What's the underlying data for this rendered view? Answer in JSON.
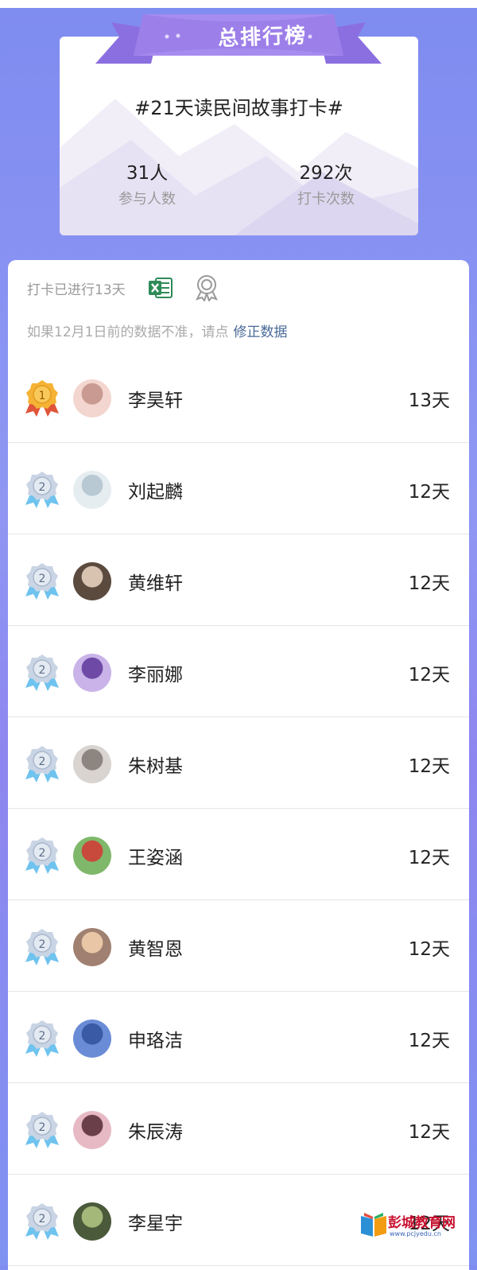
{
  "header": {
    "banner_title": "总排行榜",
    "campaign_title": "#21天读民间故事打卡#",
    "stats": [
      {
        "value": "31人",
        "label": "参与人数"
      },
      {
        "value": "292次",
        "label": "打卡次数"
      }
    ]
  },
  "info": {
    "progress_text": "打卡已进行13天",
    "notice_text": "如果12月1日前的数据不准，请点",
    "notice_link": "修正数据"
  },
  "colors": {
    "accent": "#8b8cf2",
    "banner": "#9b7be8",
    "link": "#4a6a98",
    "gold_medal": "#f5b335",
    "silver_medal": "#c9d4e4"
  },
  "rows": [
    {
      "rank": "1",
      "name": "李昊轩",
      "days": "13天",
      "medal": "gold-medal-icon"
    },
    {
      "rank": "2",
      "name": "刘起麟",
      "days": "12天",
      "medal": "silver-medal-icon"
    },
    {
      "rank": "2",
      "name": "黄维轩",
      "days": "12天",
      "medal": "silver-medal-icon"
    },
    {
      "rank": "2",
      "name": "李丽娜",
      "days": "12天",
      "medal": "silver-medal-icon"
    },
    {
      "rank": "2",
      "name": "朱树基",
      "days": "12天",
      "medal": "silver-medal-icon"
    },
    {
      "rank": "2",
      "name": "王姿涵",
      "days": "12天",
      "medal": "silver-medal-icon"
    },
    {
      "rank": "2",
      "name": "黄智恩",
      "days": "12天",
      "medal": "silver-medal-icon"
    },
    {
      "rank": "2",
      "name": "申珞洁",
      "days": "12天",
      "medal": "silver-medal-icon"
    },
    {
      "rank": "2",
      "name": "朱辰涛",
      "days": "12天",
      "medal": "silver-medal-icon"
    },
    {
      "rank": "2",
      "name": "李星宇",
      "days": "12天",
      "medal": "silver-medal-icon"
    }
  ],
  "watermark": {
    "name": "彭城教育网",
    "url": "www.pcjyedu.cn"
  }
}
